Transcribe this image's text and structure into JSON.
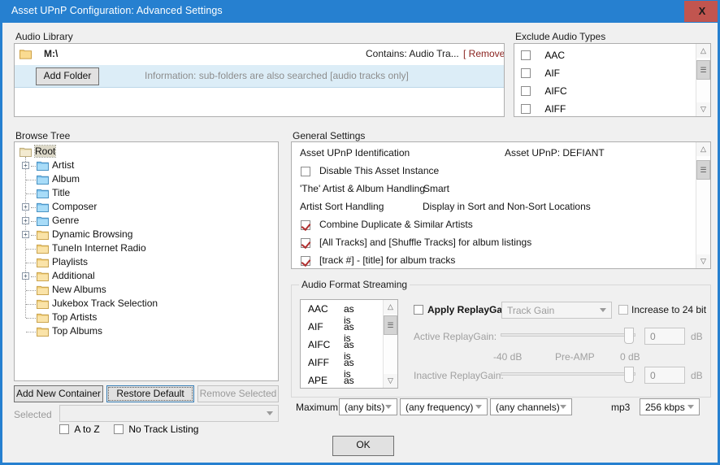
{
  "window": {
    "title": "Asset UPnP Configuration: Advanced Settings",
    "close_label": "X",
    "accent_color": "#2680d0",
    "close_color": "#c1554f"
  },
  "audio_library": {
    "group_label": "Audio Library",
    "folder_icon": "folder-icon",
    "path": "M:\\",
    "contains": "Contains: Audio Tra...",
    "remove_link": "[ Remove ]",
    "remove_color": "#8b2420",
    "add_folder_button": "Add Folder",
    "information": "Information: sub-folders are also searched [audio tracks only]"
  },
  "exclude_audio_types": {
    "group_label": "Exclude Audio Types",
    "items": [
      {
        "label": "AAC",
        "checked": false
      },
      {
        "label": "AIF",
        "checked": false
      },
      {
        "label": "AIFC",
        "checked": false
      },
      {
        "label": "AIFF",
        "checked": false
      }
    ]
  },
  "browse_tree": {
    "group_label": "Browse Tree",
    "nodes": [
      {
        "label": "Root",
        "depth": 0,
        "expander": "none",
        "folder": "folder-open-tan-icon",
        "selected": true
      },
      {
        "label": "Artist",
        "depth": 1,
        "expander": "plus",
        "folder": "folder-blue-icon",
        "selected": false
      },
      {
        "label": "Album",
        "depth": 1,
        "expander": "none",
        "folder": "folder-blue-icon",
        "selected": false
      },
      {
        "label": "Title",
        "depth": 1,
        "expander": "none",
        "folder": "folder-blue-icon",
        "selected": false
      },
      {
        "label": "Composer",
        "depth": 1,
        "expander": "plus",
        "folder": "folder-blue-icon",
        "selected": false
      },
      {
        "label": "Genre",
        "depth": 1,
        "expander": "plus",
        "folder": "folder-blue-icon",
        "selected": false
      },
      {
        "label": "Dynamic Browsing",
        "depth": 1,
        "expander": "plus",
        "folder": "folder-yellow-icon",
        "selected": false
      },
      {
        "label": "TuneIn Internet Radio",
        "depth": 1,
        "expander": "none",
        "folder": "folder-yellow-icon",
        "selected": false
      },
      {
        "label": "Playlists",
        "depth": 1,
        "expander": "none",
        "folder": "folder-yellow-icon",
        "selected": false
      },
      {
        "label": "Additional",
        "depth": 1,
        "expander": "plus",
        "folder": "folder-yellow-icon",
        "selected": false
      },
      {
        "label": "New Albums",
        "depth": 1,
        "expander": "none",
        "folder": "folder-yellow-icon",
        "selected": false
      },
      {
        "label": "Jukebox Track Selection",
        "depth": 1,
        "expander": "none",
        "folder": "folder-yellow-icon",
        "selected": false
      },
      {
        "label": "Top Artists",
        "depth": 1,
        "expander": "none",
        "folder": "folder-yellow-icon",
        "selected": false
      },
      {
        "label": "Top Albums",
        "depth": 1,
        "expander": "none",
        "folder": "folder-yellow-icon",
        "selected": false
      }
    ]
  },
  "tree_buttons": {
    "add_new_container": "Add New Container",
    "restore_default": "Restore Default",
    "remove_selected": "Remove Selected",
    "selected_label": "Selected",
    "selected_value": "",
    "a_to_z": "A to Z",
    "a_to_z_checked": false,
    "no_track_listing": "No Track Listing",
    "no_track_listing_checked": false
  },
  "general_settings": {
    "group_label": "General Settings",
    "rows": [
      {
        "label": "Asset UPnP Identification",
        "value": "Asset UPnP: DEFIANT",
        "type": "text"
      },
      {
        "label": "Disable This Asset Instance",
        "value": "",
        "type": "checkbox",
        "checked": false
      },
      {
        "label": "'The' Artist & Album Handling",
        "value": "Smart",
        "type": "text"
      },
      {
        "label": "Artist Sort Handling",
        "value": "Display in Sort and Non-Sort Locations",
        "type": "text"
      },
      {
        "label": "Combine Duplicate & Similar Artists",
        "value": "",
        "type": "checkbox",
        "checked": true
      },
      {
        "label": "[All Tracks] and [Shuffle Tracks] for album listings",
        "value": "",
        "type": "checkbox",
        "checked": true
      },
      {
        "label": "[track #] - [title] for album tracks",
        "value": "",
        "type": "checkbox",
        "checked": true
      }
    ]
  },
  "audio_format_streaming": {
    "group_label": "Audio Format Streaming",
    "formats": [
      {
        "name": "AAC",
        "mode": "as is"
      },
      {
        "name": "AIF",
        "mode": "as is"
      },
      {
        "name": "AIFC",
        "mode": "as is"
      },
      {
        "name": "AIFF",
        "mode": "as is"
      },
      {
        "name": "APE",
        "mode": "as is"
      }
    ],
    "apply_replaygain_label": "Apply ReplayGain",
    "apply_replaygain_checked": false,
    "gain_mode": "Track Gain",
    "increase_24bit_label": "Increase to 24 bit",
    "increase_24bit_checked": false,
    "active_replaygain_label": "Active ReplayGain:",
    "active_replaygain_value": "0",
    "inactive_replaygain_label": "Inactive ReplayGain:",
    "inactive_replaygain_value": "0",
    "db_unit": "dB",
    "scale_min": "-40 dB",
    "scale_mid": "Pre-AMP",
    "scale_max": "0 dB",
    "maximum_label": "Maximum",
    "max_bits": "(any bits)",
    "max_frequency": "(any frequency)",
    "max_channels": "(any channels)",
    "codec_label": "mp3",
    "bitrate": "256 kbps"
  },
  "footer": {
    "ok_label": "OK"
  }
}
